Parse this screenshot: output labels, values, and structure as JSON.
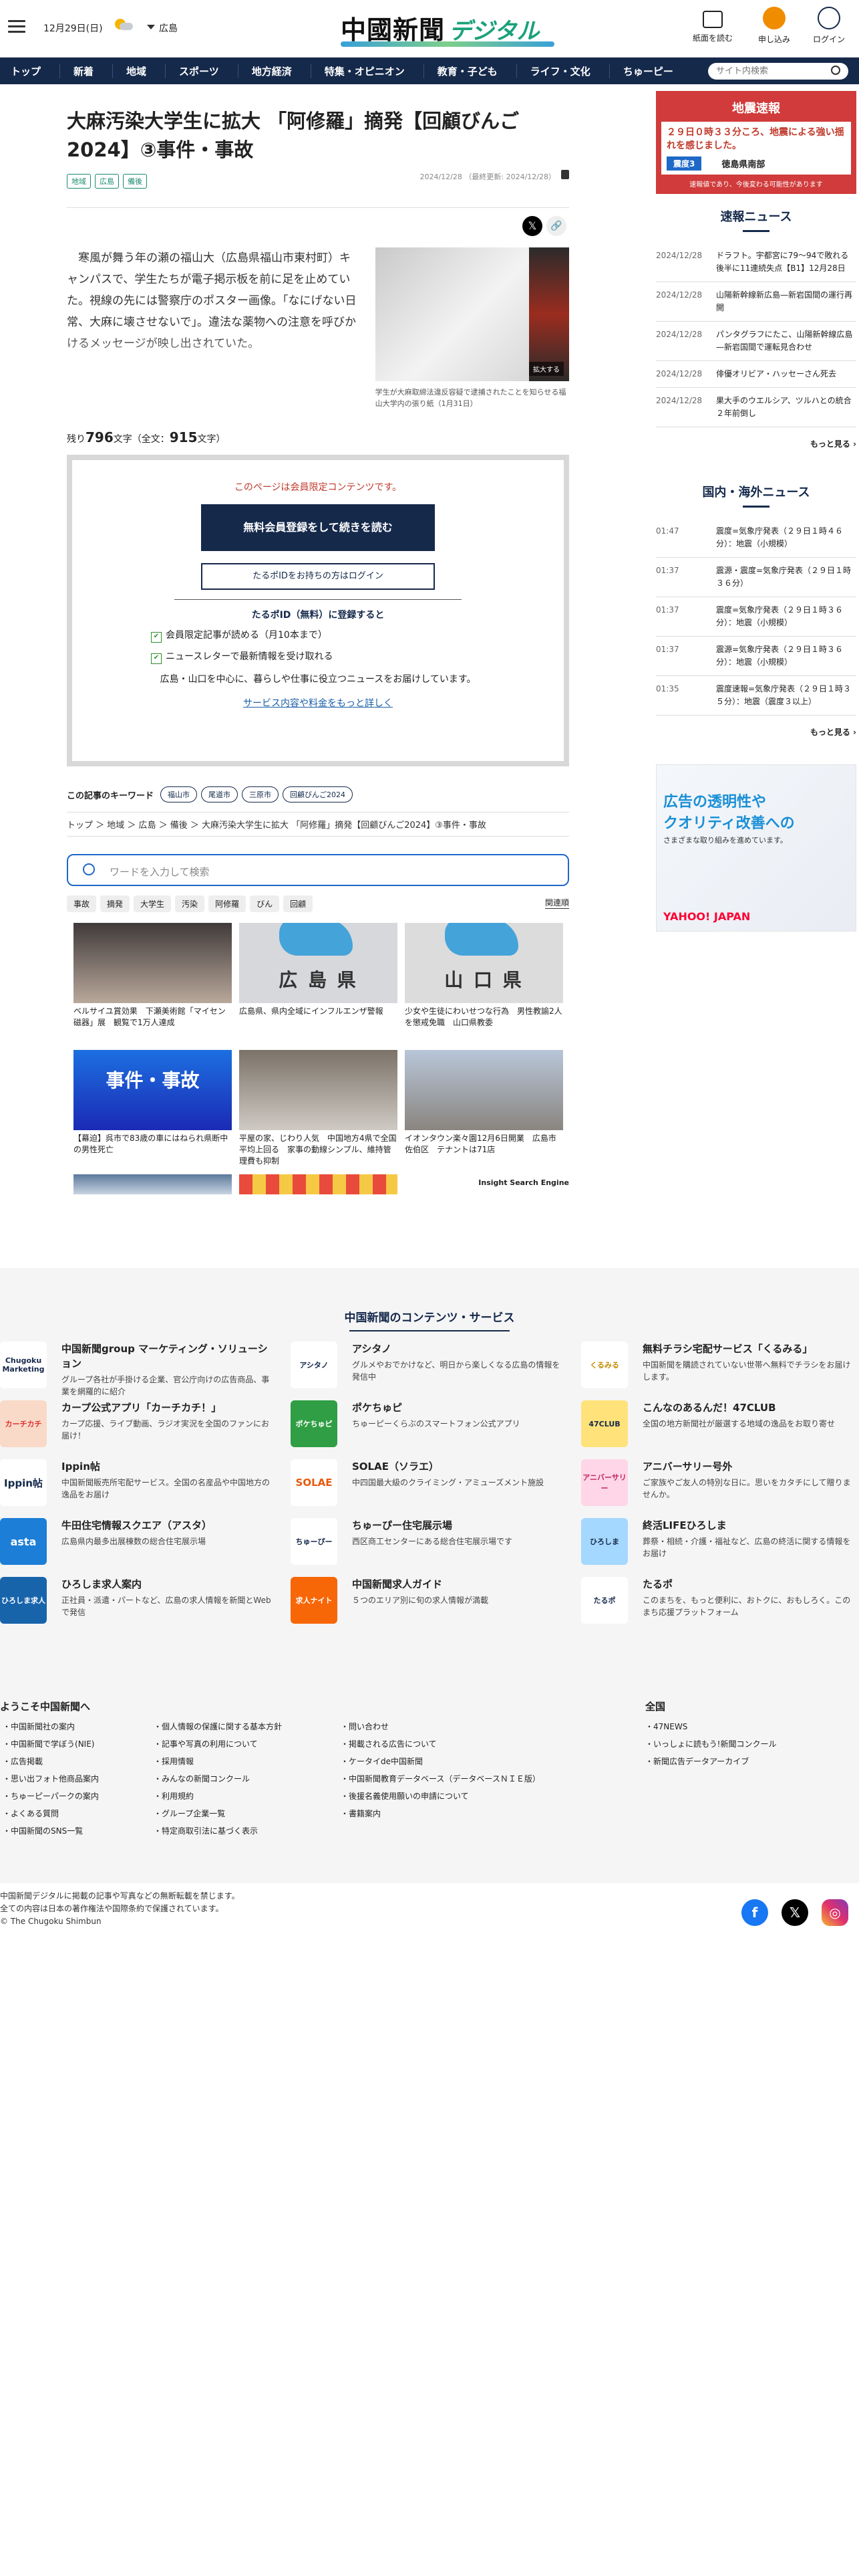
{
  "header": {
    "date": "12月29日(日)",
    "location": "広島",
    "logo_main": "中國新聞",
    "logo_sub": "デジタル",
    "buttons": [
      "紙面を読む",
      "申し込み",
      "ログイン"
    ]
  },
  "nav": {
    "items": [
      "トップ",
      "新着",
      "地域",
      "スポーツ",
      "地方経済",
      "特集・オピニオン",
      "教育・子ども",
      "ライフ・文化",
      "ちゅーピー"
    ],
    "search_placeholder": "サイト内検索"
  },
  "article": {
    "title": "大麻汚染大学生に拡大 「阿修羅」摘発【回顧びんご2024】③事件・事故",
    "tags": [
      "地域",
      "広島",
      "備後"
    ],
    "date": "2024/12/28",
    "updated": "（最終更新: 2024/12/28）",
    "lead": "寒風が舞う年の瀬の福山大（広島県福山市東村町）キャンパスで、学生たちが電子掲示板を前に足を止めていた。視線の先には警察庁のポスター画像。「なにげない日常、大麻に壊させないで」。違法な薬物への注意を呼びかけるメッセージが映し出されていた。",
    "photo_zoom": "拡大する",
    "photo_caption": "学生が大麻取締法違反容疑で逮捕されたことを知らせる福山大学内の張り紙（1月31日）",
    "remaining_label": "残り",
    "remaining_count": "796",
    "remaining_unit": "文字（全文：",
    "total_count": "915",
    "total_unit": "文字）"
  },
  "paywall": {
    "notice": "このページは会員限定コンテンツです。",
    "register_button": "無料会員登録をして続きを読む",
    "login_button": "たるポIDをお持ちの方はログイン",
    "benefit_title": "たるポID（無料）に登録すると",
    "benefits": [
      "会員限定記事が読める（月10本まで）",
      "ニュースレターで最新情報を受け取れる"
    ],
    "desc": "広島・山口を中心に、暮らしや仕事に役立つニュースをお届けしています。",
    "more_link": "サービス内容や料金をもっと詳しく"
  },
  "keywords": {
    "label": "この記事のキーワード",
    "items": [
      "福山市",
      "尾道市",
      "三原市",
      "回顧びんご2024"
    ]
  },
  "breadcrumb": "トップ ＞ 地域 ＞ 広島 ＞ 備後 ＞ 大麻汚染大学生に拡大 「阿修羅」摘発【回顧びんご2024】③事件・事故",
  "related_search": {
    "placeholder": "ワードを入力して検索",
    "chips": [
      "事故",
      "摘発",
      "大学生",
      "汚染",
      "阿修羅",
      "びん",
      "回顧"
    ],
    "sort": "関連順",
    "cards": [
      {
        "title": "ベルサイユ賞効果　下瀬美術館「マイセン磁器」展　観覧で1万人達成",
        "overlay": ""
      },
      {
        "title": "広島県、県内全域にインフルエンザ警報",
        "overlay": "広 島 県"
      },
      {
        "title": "少女や生徒にわいせつな行為　男性教諭2人を懲戒免職　山口県教委",
        "overlay": "山 口 県"
      },
      {
        "title": "【幕迫】呉市で83歳の車にはねられ県断中の男性死亡",
        "overlay": "事件・事故"
      },
      {
        "title": "平屋の家、じわり人気　中国地方4県で全国平均上回る　家事の動線シンプル、維持管理費も抑制",
        "overlay": ""
      },
      {
        "title": "イオンタウン楽々園12月6日開業　広島市佐伯区　テナントは71店",
        "overlay": ""
      }
    ],
    "engine": "Insight Search Engine"
  },
  "sidebar": {
    "quake": {
      "heading": "地震速報",
      "body": "２９日０時３３分ころ、地震による強い揺れを感じました。",
      "intensity": "震度3",
      "area": "徳島県南部",
      "footer": "速報値であり、今後変わる可能性があります"
    },
    "flash_title": "速報ニュース",
    "flash": [
      {
        "date": "2024/12/28",
        "text": "ドラフト。宇都宮に79〜94で敗れる　後半に11連続失点【B1】12月28日"
      },
      {
        "date": "2024/12/28",
        "text": "山陽新幹線新広島—新岩国間の運行再開"
      },
      {
        "date": "2024/12/28",
        "text": "パンタグラフにたこ、山陽新幹線広島—新岩国間で運転見合わせ"
      },
      {
        "date": "2024/12/28",
        "text": "俳優オリビア・ハッセーさん死去"
      },
      {
        "date": "2024/12/28",
        "text": "果大手のウエルシア、ツルハとの統合２年前倒し"
      }
    ],
    "more": "もっと見る",
    "intl_title": "国内・海外ニュース",
    "intl": [
      {
        "date": "01:47",
        "text": "震度=気象庁発表（２９日１時４６分）：地震（小規模）"
      },
      {
        "date": "01:37",
        "text": "震源・震度=気象庁発表（２９日１時３６分）"
      },
      {
        "date": "01:37",
        "text": "震度=気象庁発表（２９日１時３６分）：地震（小規模）"
      },
      {
        "date": "01:37",
        "text": "震源=気象庁発表（２９日１時３６分）：地震（小規模）"
      },
      {
        "date": "01:35",
        "text": "震度速報=気象庁発表（２９日１時３５分）：地震（震度３以上）"
      }
    ],
    "ad": {
      "line1": "広告の透明性や",
      "line2": "クオリティ改善への",
      "line3": "さまざまな取り組みを進めています。",
      "brand": "YAHOO! JAPAN"
    }
  },
  "footer": {
    "title": "中国新聞のコンテンツ・サービス",
    "services": [
      {
        "logo": "Chugoku Marketing",
        "name": "中国新聞group マーケティング・ソリューション",
        "desc": "グループ各社が手掛ける企業、官公庁向けの広告商品、事業を網羅的に紹介"
      },
      {
        "logo": "アシタノ",
        "name": "アシタノ",
        "desc": "グルメやおでかけなど、明日から楽しくなる広島の情報を発信中"
      },
      {
        "logo": "くるみる",
        "name": "無料チラシ宅配サービス「くるみる」",
        "desc": "中国新聞を購読されていない世帯へ無料でチラシをお届けします。"
      },
      {
        "logo": "カーチカチ",
        "name": "カープ公式アプリ「カーチカチ！」",
        "desc": "カープ応援、ライブ動画、ラジオ実況を全国のファンにお届け！"
      },
      {
        "logo": "ポケちゅピ",
        "name": "ポケちゅピ",
        "desc": "ちゅーピーくらぶのスマートフォン公式アプリ"
      },
      {
        "logo": "47CLUB",
        "name": "こんなのあるんだ！47CLUB",
        "desc": "全国の地方新聞社が厳選する地域の逸品をお取り寄せ"
      },
      {
        "logo": "Ippin帖",
        "name": "Ippin帖",
        "desc": "中国新聞販売所宅配サービス。全国の名産品や中国地方の逸品をお届け"
      },
      {
        "logo": "SOLAE",
        "name": "SOLAE（ソラエ）",
        "desc": "中四国最大級のクライミング・アミューズメント施設"
      },
      {
        "logo": "アニバーサリー",
        "name": "アニバーサリー号外",
        "desc": "ご家族やご友人の特別な日に。思いをカタチにして贈りませんか。"
      },
      {
        "logo": "asta",
        "name": "牛田住宅情報スクエア（アスタ）",
        "desc": "広島県内最多出展棟数の総合住宅展示場"
      },
      {
        "logo": "ちゅーぴー",
        "name": "ちゅーぴー住宅展示場",
        "desc": "西区商工センターにある総合住宅展示場です"
      },
      {
        "logo": "ひろしま",
        "name": "終活LIFEひろしま",
        "desc": "葬祭・相続・介護・福祉など、広島の終活に関する情報をお届け"
      },
      {
        "logo": "ひろしま求人",
        "name": "ひろしま求人案内",
        "desc": "正社員・派遣・パートなど、広島の求人情報を新聞とWebで発信"
      },
      {
        "logo": "求人ナイト",
        "name": "中国新聞求人ガイド",
        "desc": "５つのエリア別に旬の求人情報が満載"
      },
      {
        "logo": "たるポ",
        "name": "たるポ",
        "desc": "このまちを、もっと便利に、おトクに、おもしろく。このまち応援プラットフォーム"
      }
    ],
    "welcome_title": "ようこそ中国新聞へ",
    "col1": [
      "中国新聞社の案内",
      "中国新聞で学ぼう(NIE)",
      "広告掲載",
      "思い出フォト他商品案内",
      "ちゅーピーパークの案内",
      "よくある質問",
      "中国新聞のSNS一覧"
    ],
    "col2": [
      "個人情報の保護に関する基本方針",
      "記事や写真の利用について",
      "採用情報",
      "みんなの新聞コンクール",
      "利用規約",
      "グループ企業一覧",
      "特定商取引法に基づく表示"
    ],
    "col3": [
      "問い合わせ",
      "掲載される広告について",
      "ケータイde中国新聞",
      "中国新聞教育データベース（データベースＮＩＥ版）",
      "後援名義使用願いの申請について",
      "書籍案内"
    ],
    "national_title": "全国",
    "col4": [
      "47NEWS",
      "いっしょに読もう!新聞コンクール",
      "新聞広告データアーカイブ"
    ],
    "copyright1": "中国新聞デジタルに掲載の記事や写真などの無断転載を禁じます。",
    "copyright2": "全ての内容は日本の著作権法や国際条約で保護されています。",
    "copyright3": "© The Chugoku Shimbun"
  }
}
